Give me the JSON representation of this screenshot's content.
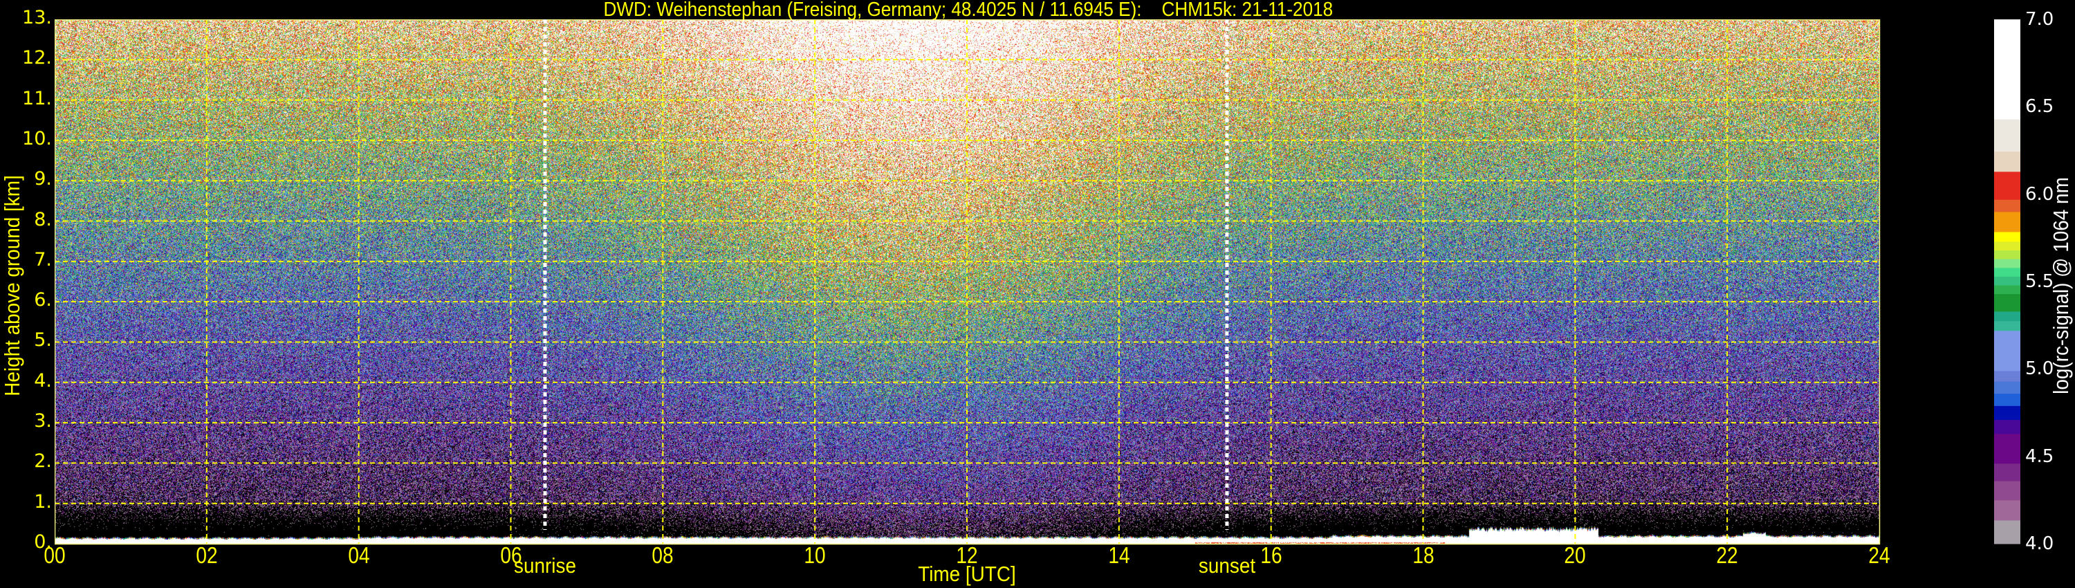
{
  "chart_data": {
    "type": "heatmap",
    "title": "DWD: Weihenstephan (Freising, Germany; 48.4025 N / 11.6945 E):    CHM15k: 21-11-2018",
    "xlabel": "Time [UTC]",
    "ylabel": "Height above ground [km]",
    "xlim": [
      0,
      24
    ],
    "ylim": [
      0,
      13
    ],
    "x_ticks": [
      0,
      2,
      4,
      6,
      8,
      10,
      12,
      14,
      16,
      18,
      20,
      22,
      24
    ],
    "x_tick_labels": [
      "00",
      "02",
      "04",
      "06",
      "08",
      "10",
      "12",
      "14",
      "16",
      "18",
      "20",
      "22",
      "24"
    ],
    "y_ticks": [
      0,
      1,
      2,
      3,
      4,
      5,
      6,
      7,
      8,
      9,
      10,
      11,
      12,
      13
    ],
    "y_tick_labels": [
      "0.",
      "1.",
      "2.",
      "3.",
      "4.",
      "5.",
      "6.",
      "7.",
      "8.",
      "9.",
      "10.",
      "11.",
      "12.",
      "13."
    ],
    "grid": true,
    "grid_color": "#ffff00",
    "annotations": [
      {
        "label": "sunrise",
        "time": 6.45
      },
      {
        "label": "sunset",
        "time": 15.42
      }
    ],
    "colorbar": {
      "label": "log(rc-signal) @ 1064 nm",
      "range": [
        4.0,
        7.0
      ],
      "ticks": [
        4.0,
        4.5,
        5.0,
        5.5,
        6.0,
        6.5,
        7.0
      ],
      "tick_labels": [
        "4.0",
        "4.5",
        "5.0",
        "5.5",
        "6.0",
        "6.5",
        "7.0"
      ],
      "segments": [
        {
          "from": 4.0,
          "to": 4.135,
          "color": "#a8a0a8"
        },
        {
          "from": 4.135,
          "to": 4.25,
          "color": "#a06898"
        },
        {
          "from": 4.25,
          "to": 4.36,
          "color": "#904a90"
        },
        {
          "from": 4.36,
          "to": 4.46,
          "color": "#7a2a88"
        },
        {
          "from": 4.46,
          "to": 4.63,
          "color": "#6a0888"
        },
        {
          "from": 4.63,
          "to": 4.71,
          "color": "#4a0898"
        },
        {
          "from": 4.71,
          "to": 4.79,
          "color": "#0010b0"
        },
        {
          "from": 4.79,
          "to": 4.86,
          "color": "#2060d8"
        },
        {
          "from": 4.86,
          "to": 4.93,
          "color": "#4a78d8"
        },
        {
          "from": 4.93,
          "to": 4.99,
          "color": "#6a80d8"
        },
        {
          "from": 4.99,
          "to": 5.22,
          "color": "#8098e8"
        },
        {
          "from": 5.22,
          "to": 5.275,
          "color": "#36b898"
        },
        {
          "from": 5.275,
          "to": 5.33,
          "color": "#20a888"
        },
        {
          "from": 5.33,
          "to": 5.43,
          "color": "#1a9632"
        },
        {
          "from": 5.43,
          "to": 5.48,
          "color": "#2cb050"
        },
        {
          "from": 5.48,
          "to": 5.53,
          "color": "#36c080"
        },
        {
          "from": 5.53,
          "to": 5.58,
          "color": "#40dc8a"
        },
        {
          "from": 5.58,
          "to": 5.63,
          "color": "#80e888"
        },
        {
          "from": 5.63,
          "to": 5.68,
          "color": "#b5e845"
        },
        {
          "from": 5.68,
          "to": 5.73,
          "color": "#e0ee2a"
        },
        {
          "from": 5.73,
          "to": 5.785,
          "color": "#ffff00"
        },
        {
          "from": 5.785,
          "to": 5.9,
          "color": "#f29a0a"
        },
        {
          "from": 5.9,
          "to": 5.97,
          "color": "#e5602a"
        },
        {
          "from": 5.97,
          "to": 6.13,
          "color": "#e52a20"
        },
        {
          "from": 6.13,
          "to": 6.245,
          "color": "#e8d5c0"
        },
        {
          "from": 6.245,
          "to": 6.43,
          "color": "#ede8df"
        },
        {
          "from": 6.43,
          "to": 7.0,
          "color": "#ffffff"
        }
      ]
    }
  }
}
